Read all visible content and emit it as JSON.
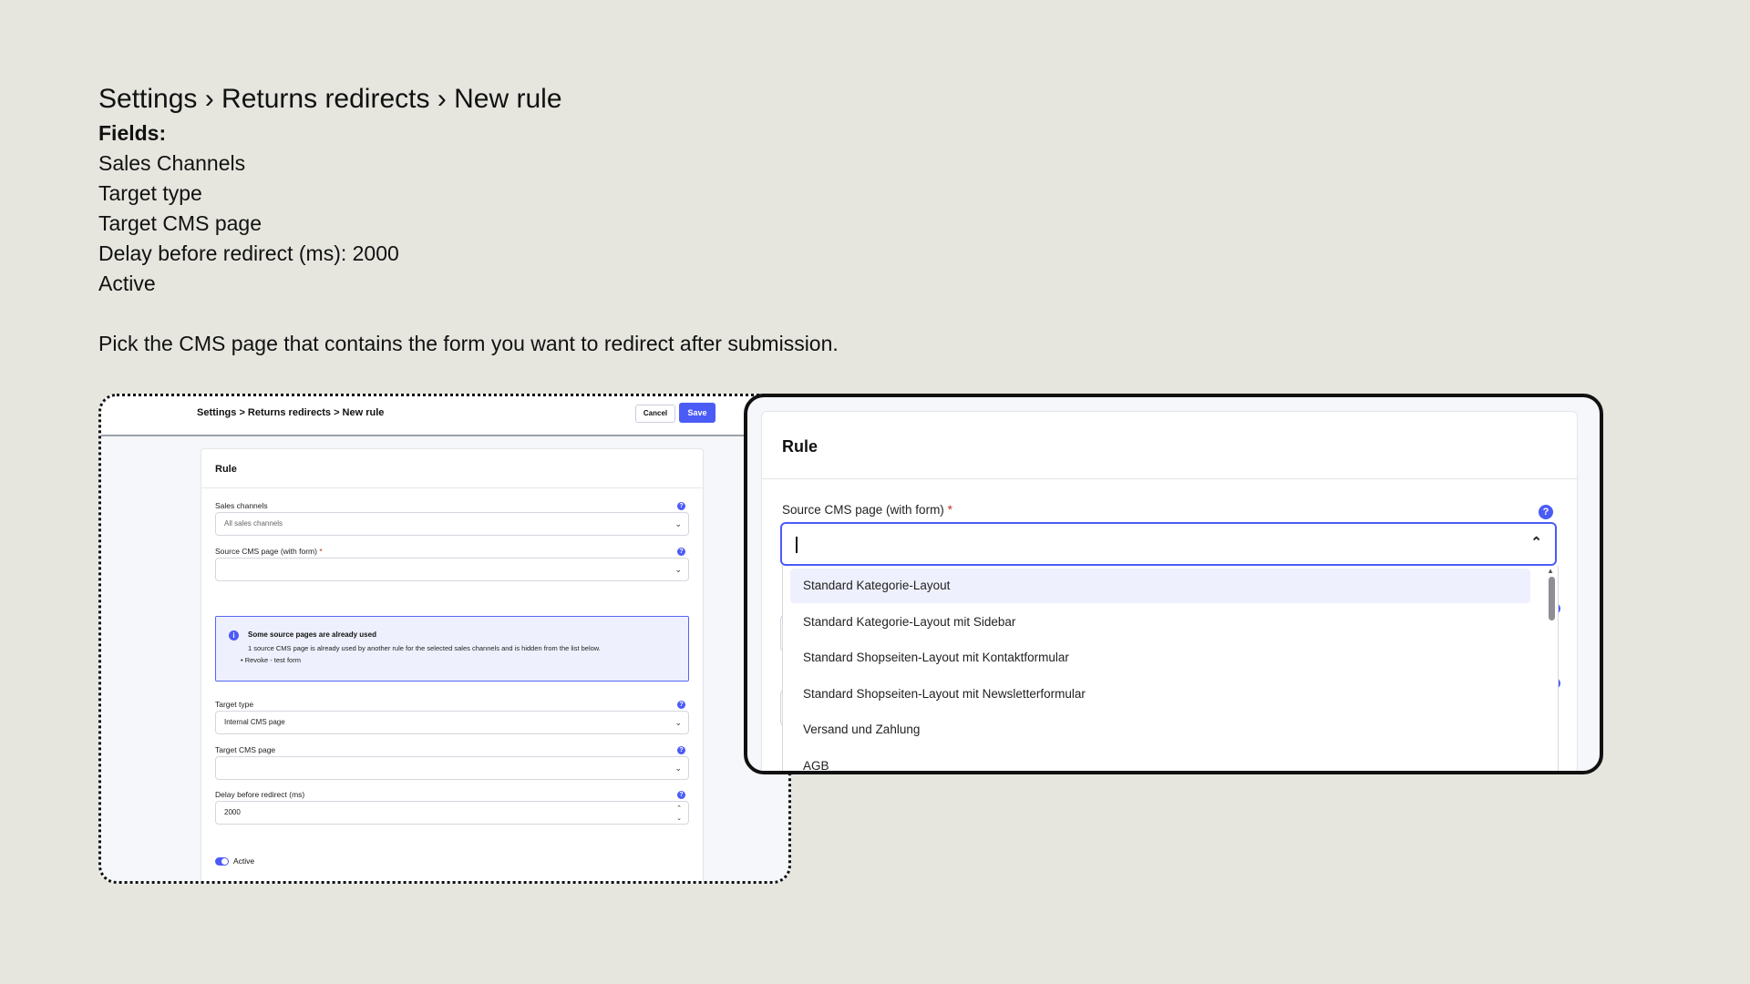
{
  "intro": {
    "title": "Settings › Returns redirects › New rule",
    "fields_heading": "Fields:",
    "fields": [
      "Sales Channels",
      "Target type",
      "Target CMS page",
      "Delay before redirect (ms): 2000",
      "Active"
    ],
    "hint": "Pick the CMS page that contains the form you want to redirect after submission."
  },
  "left_panel": {
    "breadcrumb": "Settings > Returns redirects > New rule",
    "cancel_label": "Cancel",
    "save_label": "Save",
    "card_title": "Rule",
    "sales_channels": {
      "label": "Sales channels",
      "value": "All sales channels"
    },
    "source_cms": {
      "label": "Source CMS page (with form)",
      "required_mark": "*",
      "value": ""
    },
    "notice": {
      "title": "Some source pages are already used",
      "text": "1 source CMS page is already used by another rule for the selected sales channels and is hidden from the list below.",
      "bullet": "• Revoke - test form"
    },
    "target_type": {
      "label": "Target type",
      "value": "Internal CMS page"
    },
    "target_cms": {
      "label": "Target CMS page",
      "value": ""
    },
    "delay": {
      "label": "Delay before redirect (ms)",
      "value": "2000"
    },
    "active_label": "Active",
    "colors": {
      "accent": "#4b5bf6"
    }
  },
  "right_panel": {
    "card_title": "Rule",
    "source_cms": {
      "label": "Source CMS page (with form)",
      "required_mark": "*",
      "value": ""
    },
    "options": [
      "Standard Kategorie-Layout",
      "Standard Kategorie-Layout mit Sidebar",
      "Standard Shopseiten-Layout mit Kontaktformular",
      "Standard Shopseiten-Layout mit Newsletterformular",
      "Versand und Zahlung",
      "AGB"
    ],
    "highlighted_option": "Standard Kategorie-Layout"
  },
  "icons": {
    "help": "?",
    "info": "i",
    "chevron_down": "⌄",
    "chevron_up": "⌃",
    "scroll_up": "▲",
    "scroll_down": "▼"
  }
}
